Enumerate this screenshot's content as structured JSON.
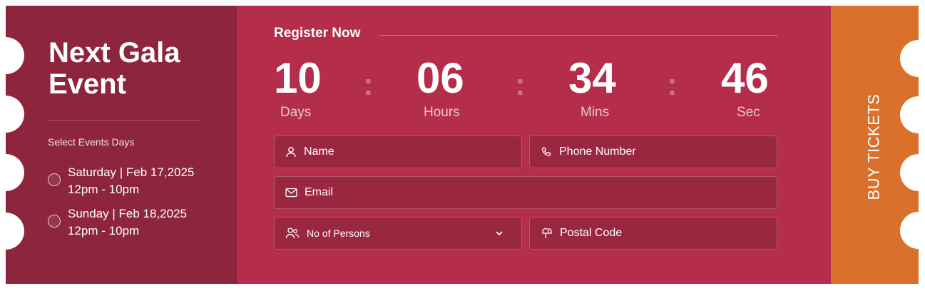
{
  "event": {
    "title_line1": "Next Gala",
    "title_line2": "Event"
  },
  "days": {
    "label": "Select Events Days",
    "items": [
      {
        "line1": "Saturday | Feb 17,2025",
        "line2": "12pm - 10pm"
      },
      {
        "line1": "Sunday | Feb 18,2025",
        "line2": "12pm - 10pm"
      }
    ]
  },
  "register": {
    "title": "Register Now"
  },
  "countdown": [
    {
      "value": "10",
      "label": "Days"
    },
    {
      "value": "06",
      "label": "Hours"
    },
    {
      "value": "34",
      "label": "Mins"
    },
    {
      "value": "46",
      "label": "Sec"
    }
  ],
  "form": {
    "name": "Name",
    "phone": "Phone Number",
    "email": "Email",
    "persons": "No of Persons",
    "postal": "Postal Code"
  },
  "buy_button": "BUY TICKETS",
  "colors": {
    "left": "#8d263c",
    "middle": "#b42d4a",
    "right": "#d9712c"
  }
}
